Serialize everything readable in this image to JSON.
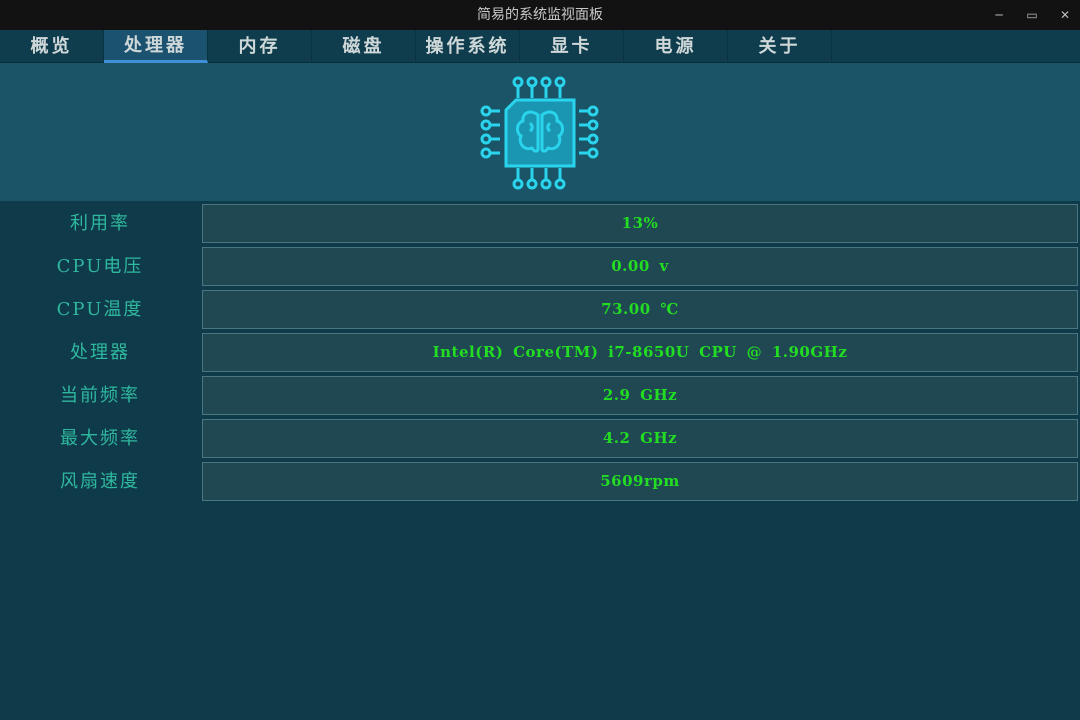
{
  "window": {
    "title": "简易的系统监视面板",
    "minimize_icon": "minimize-icon",
    "maximize_icon": "maximize-icon",
    "close_icon": "close-icon"
  },
  "tabs": [
    {
      "label": "概览"
    },
    {
      "label": "处理器",
      "active": true
    },
    {
      "label": "内存"
    },
    {
      "label": "磁盘"
    },
    {
      "label": "操作系统"
    },
    {
      "label": "显卡"
    },
    {
      "label": "电源"
    },
    {
      "label": "关于"
    }
  ],
  "banner": {
    "icon": "cpu-brain-icon",
    "color": "#2ad4ec"
  },
  "rows": [
    {
      "label": "利用率",
      "value": "13%"
    },
    {
      "label": "CPU电压",
      "value": "0.00 v"
    },
    {
      "label": "CPU温度",
      "value": "73.00 ℃"
    },
    {
      "label": "处理器",
      "value": "Intel(R) Core(TM) i7-8650U CPU @ 1.90GHz"
    },
    {
      "label": "当前频率",
      "value": "2.9 GHz"
    },
    {
      "label": "最大频率",
      "value": "4.2 GHz"
    },
    {
      "label": "风扇速度",
      "value": "5609rpm"
    }
  ],
  "colors": {
    "value_text": "#22dd22",
    "label_text": "#2fb89e",
    "active_tab_indicator": "#3e8fd6"
  }
}
